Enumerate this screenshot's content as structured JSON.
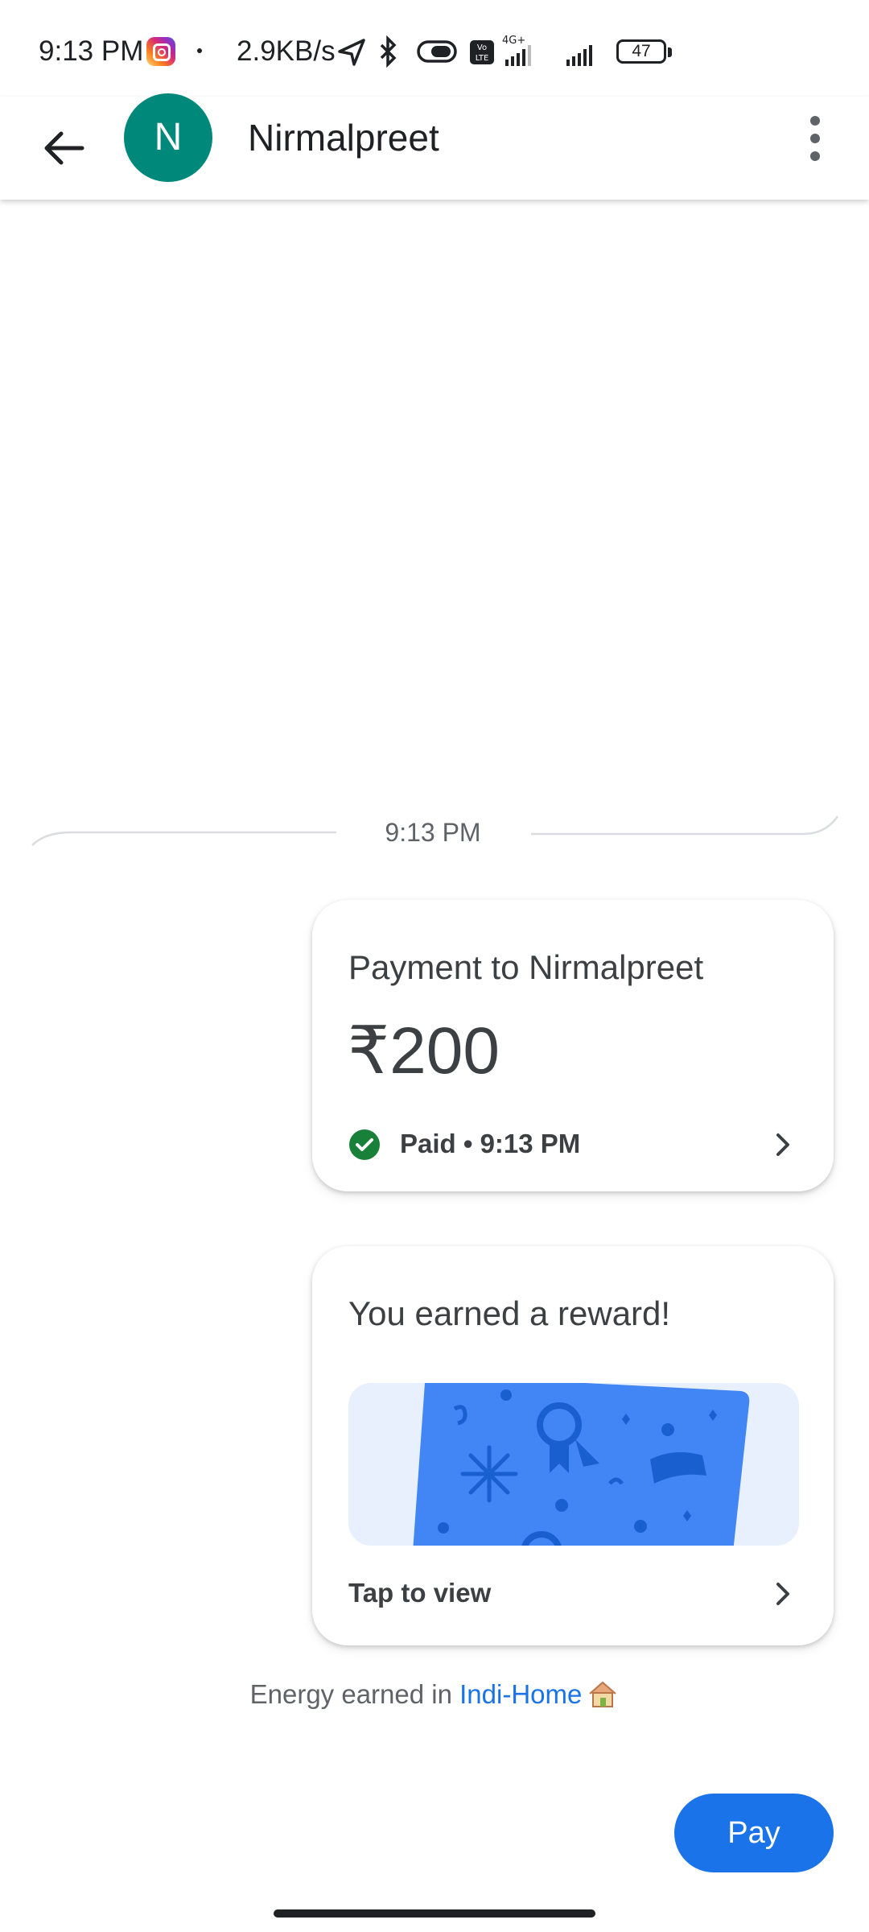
{
  "status_bar": {
    "time": "9:13 PM",
    "network_speed": "2.9KB/s",
    "battery_level": "47",
    "icons": [
      "instagram-icon",
      "location-arrow-icon",
      "bluetooth-icon",
      "toggle-icon",
      "volte-icon",
      "signal-4g-icon",
      "signal-icon",
      "battery-icon"
    ]
  },
  "header": {
    "avatar_initial": "N",
    "contact_name": "Nirmalpreet",
    "avatar_color": "#00897b"
  },
  "conversation": {
    "timestamp": "9:13 PM",
    "payment_card": {
      "title": "Payment to Nirmalpreet",
      "amount": "₹200",
      "status": "Paid • 9:13 PM",
      "status_color": "#188038"
    },
    "reward_card": {
      "title": "You earned a reward!",
      "action": "Tap to view",
      "scratch_color": "#4285f4"
    },
    "energy_prefix": "Energy earned in ",
    "energy_link": "Indi-Home"
  },
  "pay_button": {
    "label": "Pay",
    "color": "#1a73e8"
  }
}
